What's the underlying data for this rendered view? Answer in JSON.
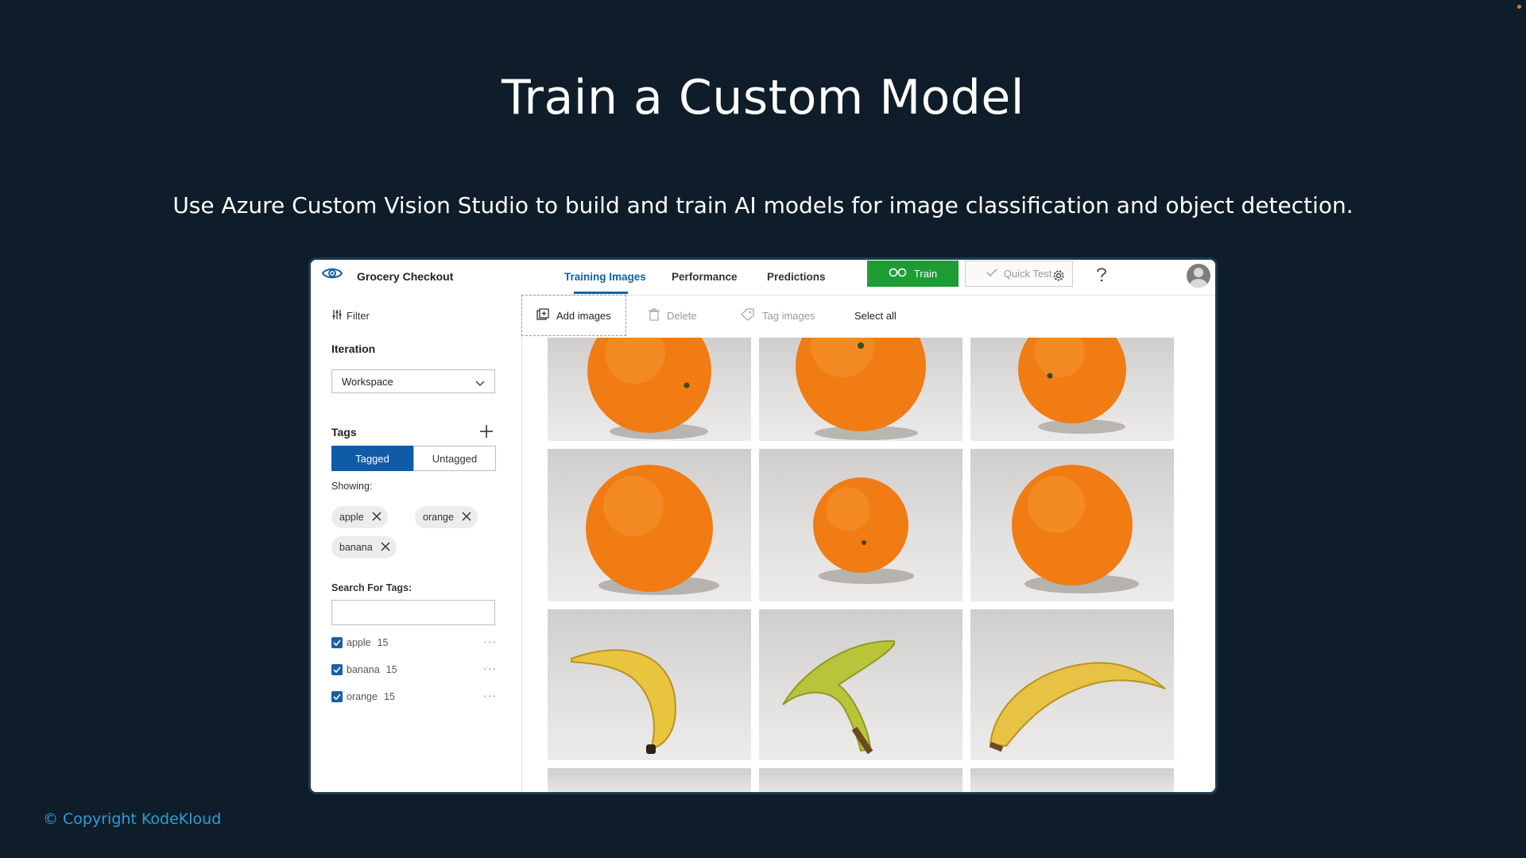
{
  "slide": {
    "title": "Train a Custom Model",
    "subtitle": "Use Azure Custom Vision Studio to build and train AI models for image classification and object detection.",
    "copyright": "© Copyright KodeKloud"
  },
  "app": {
    "project_name": "Grocery Checkout",
    "nav_tabs": [
      {
        "label": "Training Images",
        "active": true
      },
      {
        "label": "Performance",
        "active": false
      },
      {
        "label": "Predictions",
        "active": false
      }
    ],
    "train_label": "Train",
    "quick_test_label": "Quick Test",
    "icons": [
      "eye-icon",
      "train-icon",
      "check-icon",
      "gear-icon",
      "help-icon",
      "avatar"
    ]
  },
  "sidebar": {
    "filter_label": "Filter",
    "iteration_heading": "Iteration",
    "iteration_value": "Workspace",
    "tags_heading": "Tags",
    "toggle": {
      "tagged": "Tagged",
      "untagged": "Untagged",
      "selected": "Tagged"
    },
    "showing_label": "Showing:",
    "showing_chips": [
      "apple",
      "orange",
      "banana"
    ],
    "search_label": "Search For Tags:",
    "search_value": "",
    "tag_list": [
      {
        "name": "apple",
        "count": "15",
        "checked": true
      },
      {
        "name": "banana",
        "count": "15",
        "checked": true
      },
      {
        "name": "orange",
        "count": "15",
        "checked": true
      }
    ]
  },
  "toolbar": {
    "add_images": "Add images",
    "delete": "Delete",
    "tag_images": "Tag images",
    "select_all": "Select all"
  },
  "images": [
    "orange",
    "orange",
    "orange",
    "orange",
    "orange",
    "orange",
    "banana",
    "banana",
    "banana",
    "unknown",
    "unknown",
    "unknown"
  ],
  "colors": {
    "background": "#0f1d2a",
    "accent_blue": "#0f62a8",
    "train_green": "#1e9c34",
    "copyright_blue": "#2a9fd6"
  }
}
